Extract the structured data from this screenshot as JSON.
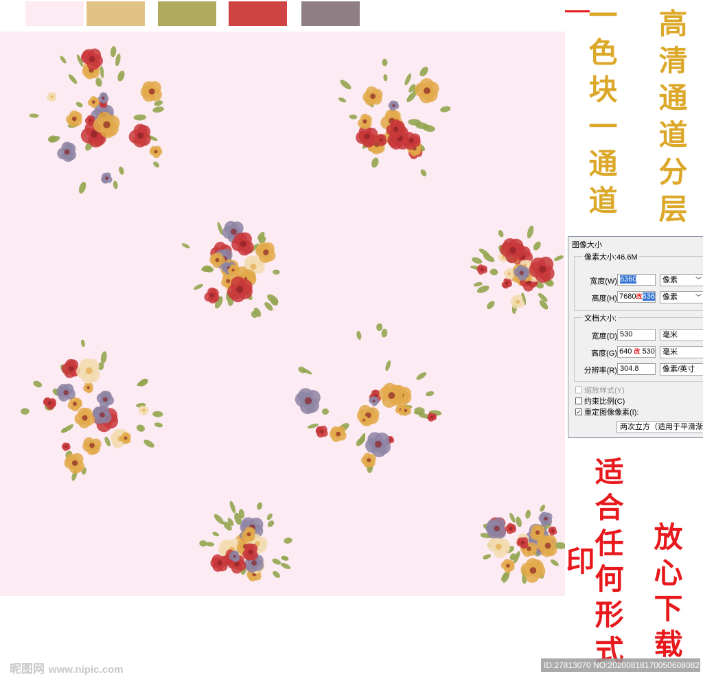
{
  "swatches": [
    "#fcebf2",
    "#e2c285",
    "#b1a95e",
    "#cf4343",
    "#8f7e84"
  ],
  "pattern": {
    "background": "#fcebf2",
    "palette": {
      "red": "#c8373a",
      "gold": "#e2a94a",
      "cream": "#f2dcb0",
      "leaf": "#93a550",
      "lilac": "#8d84a3"
    }
  },
  "slogans": {
    "gold_1": "一色块一通道",
    "gold_2": "高清通道分层",
    "red_1": "适合任何形式印",
    "red_2": "放心下载"
  },
  "dialog": {
    "title": "图像大小",
    "pixel_dims_label": "像素大小:46.6M",
    "width_label": "宽度(W):",
    "width_value": "6360",
    "width_unit": "像素",
    "height_label": "高度(H):",
    "height_old": "7680",
    "height_mark": "改",
    "height_new": "6360",
    "height_unit": "像素",
    "doc_size_label": "文档大小:",
    "doc_width_label": "宽度(D):",
    "doc_width_value": "530",
    "doc_width_unit": "毫米",
    "doc_height_label": "高度(G):",
    "doc_height_old": "640",
    "doc_height_mark": "改",
    "doc_height_new": "530",
    "doc_height_unit": "毫米",
    "resolution_label": "分辨率(R):",
    "resolution_value": "304.8",
    "resolution_unit": "像素/英寸",
    "scale_styles_label": "缩放样式(Y)",
    "constrain_label": "约束比例(C)",
    "resample_label": "重定图像像素(I):",
    "resample_method": "两次立方（适用于平滑渐变"
  },
  "watermark": {
    "brand": "昵图网",
    "url": "www.nipic.com",
    "id_text": "ID:27813070 NO:20200818170050608082"
  }
}
